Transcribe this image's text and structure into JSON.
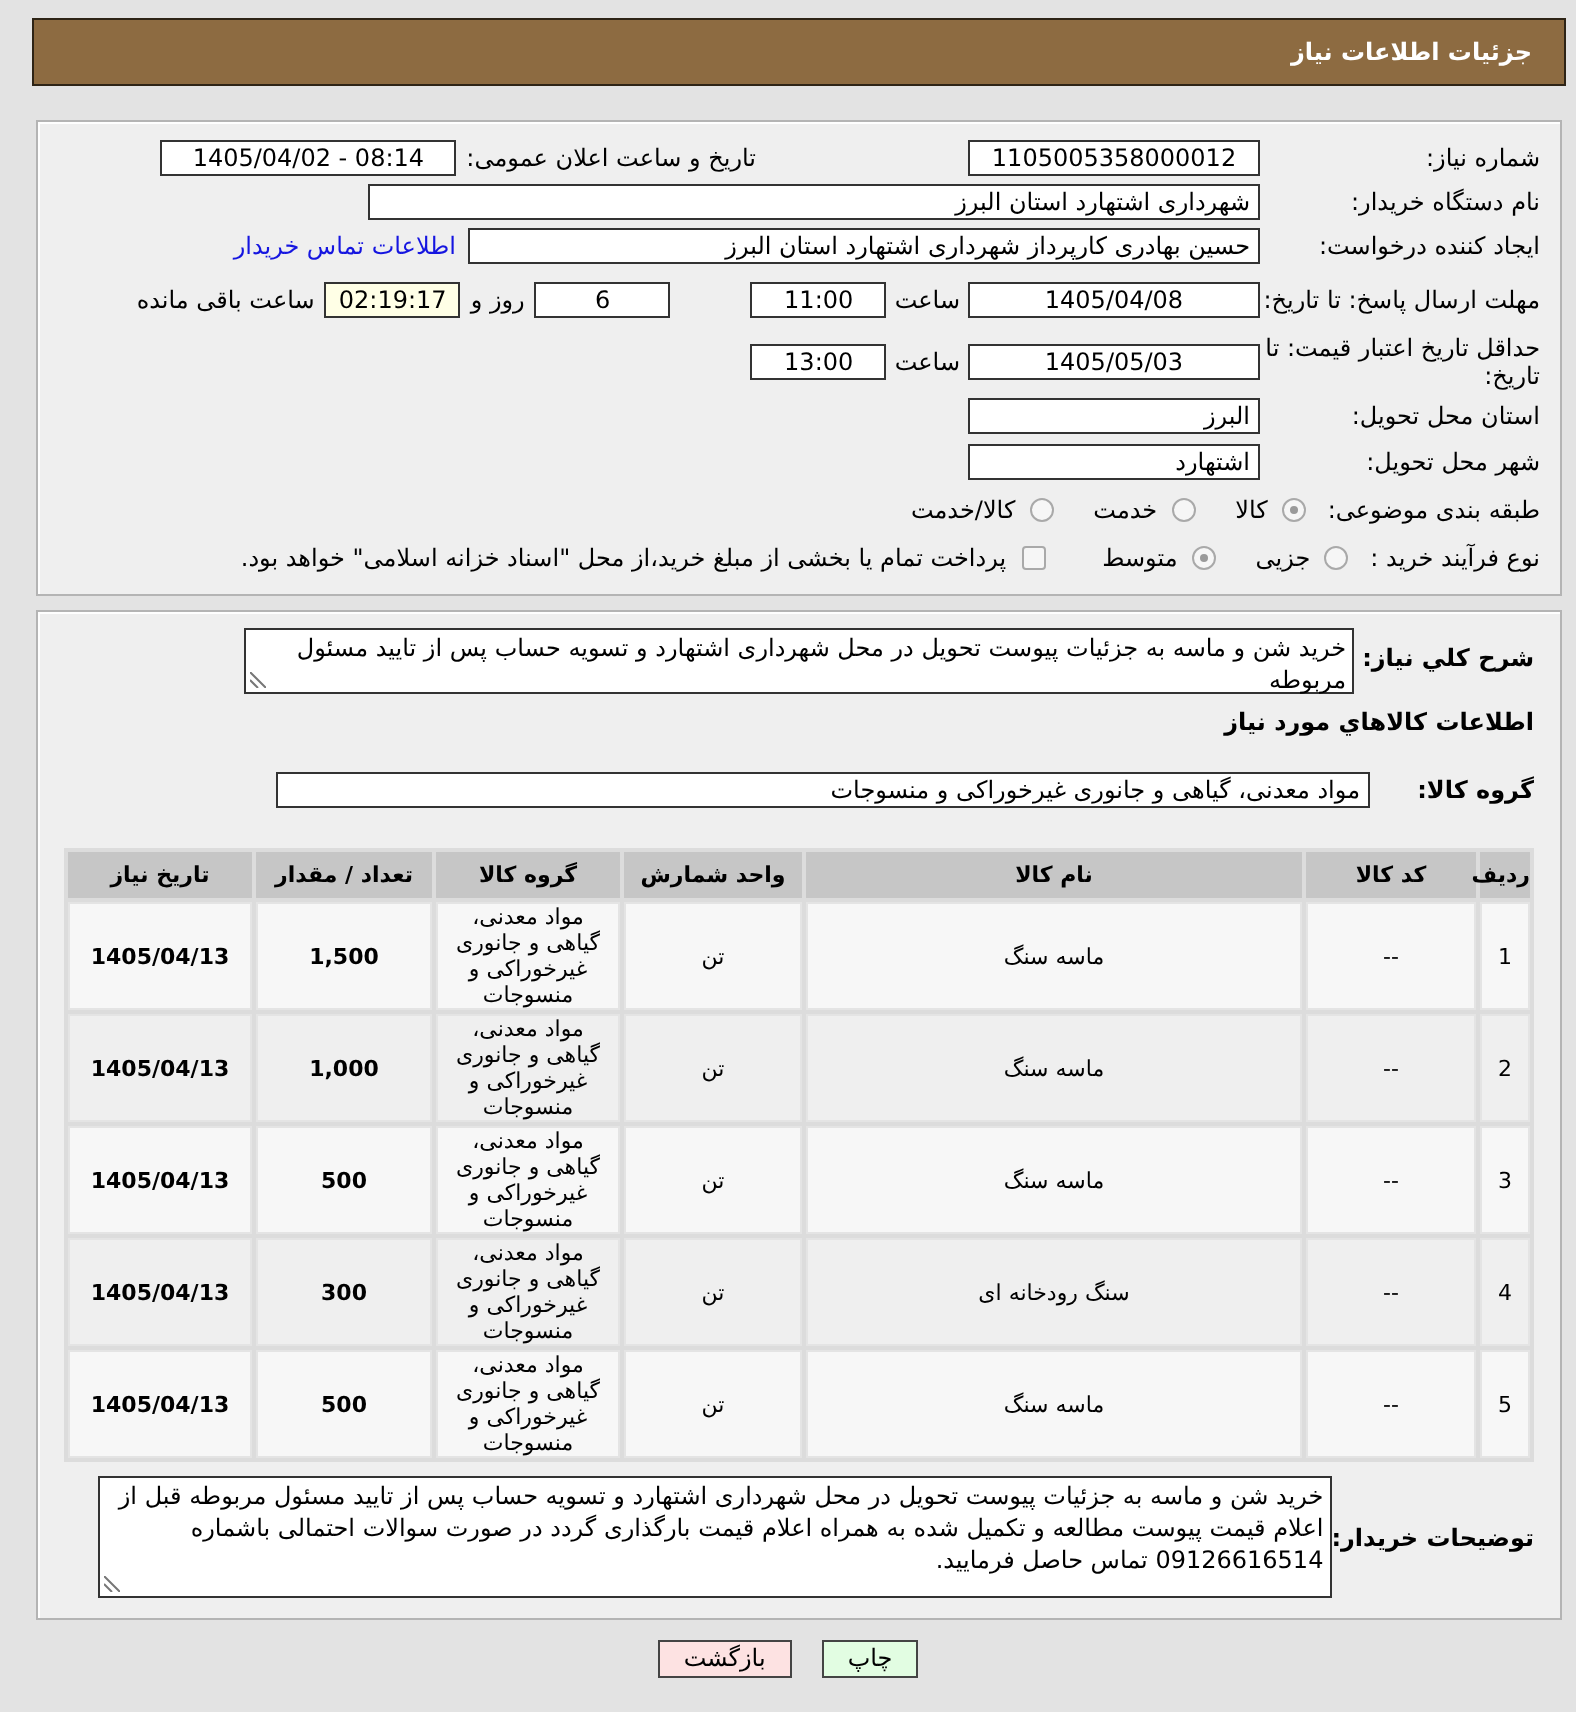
{
  "header": {
    "title": "جزئیات اطلاعات نیاز"
  },
  "details": {
    "need_number": {
      "label": "شماره نیاز:",
      "value": "1105005358000012"
    },
    "announcement": {
      "label": "تاریخ و ساعت اعلان عمومی:",
      "value": "1405/04/02 - 08:14"
    },
    "buyer_organization": {
      "label": "نام دستگاه خریدار:",
      "value": "شهرداری اشتهارد استان البرز"
    },
    "requester": {
      "label": "ایجاد کننده درخواست:",
      "value": "حسین بهادری کارپرداز شهرداری اشتهارد استان البرز",
      "contact_link": "اطلاعات تماس خریدار"
    },
    "response_deadline": {
      "label": "مهلت ارسال پاسخ: تا تاریخ:",
      "date": "1405/04/08",
      "time_label": "ساعت",
      "time": "11:00",
      "days": "6",
      "days_label": "روز و",
      "remaining": "02:19:17",
      "remaining_label": "ساعت باقی مانده"
    },
    "price_validity": {
      "label": "حداقل تاریخ اعتبار قیمت: تا تاریخ:",
      "date": "1405/05/03",
      "time_label": "ساعت",
      "time": "13:00"
    },
    "delivery_province": {
      "label": "استان محل تحویل:",
      "value": "البرز"
    },
    "delivery_city": {
      "label": "شهر محل تحویل:",
      "value": "اشتهارد"
    },
    "subject_category": {
      "label": "طبقه بندی موضوعی:",
      "options": [
        {
          "label": "کالا",
          "selected": true
        },
        {
          "label": "خدمت",
          "selected": false
        },
        {
          "label": "کالا/خدمت",
          "selected": false
        }
      ]
    },
    "purchase_process": {
      "label": "نوع فرآیند خرید :",
      "options": [
        {
          "label": "جزیی",
          "selected": false
        },
        {
          "label": "متوسط",
          "selected": true
        }
      ],
      "treasury_payment": {
        "label": "پرداخت تمام یا بخشی از مبلغ خرید،از محل \"اسناد خزانه اسلامی\" خواهد بود.",
        "checked": false
      }
    }
  },
  "goods": {
    "description": {
      "label": "شرح کلي نیاز:",
      "value": "خرید شن و ماسه به جزئیات پیوست تحویل در محل شهرداری اشتهارد و تسویه حساب پس از تایید مسئول مربوطه"
    },
    "section_title": "اطلاعات کالاهاي مورد نیاز",
    "group": {
      "label": "گروه کالا:",
      "value": "مواد معدنی، گیاهی و جانوری غیرخوراکی و منسوجات"
    },
    "table": {
      "columns": [
        "ردیف",
        "کد کالا",
        "نام کالا",
        "واحد شمارش",
        "گروه کالا",
        "تعداد / مقدار",
        "تاریخ نیاز"
      ],
      "rows": [
        {
          "row": "1",
          "code": "--",
          "name": "ماسه سنگ",
          "unit": "تن",
          "group": "مواد معدنی، گیاهی و جانوری غیرخوراکی و منسوجات",
          "quantity": "1,500",
          "need_date": "1405/04/13"
        },
        {
          "row": "2",
          "code": "--",
          "name": "ماسه سنگ",
          "unit": "تن",
          "group": "مواد معدنی، گیاهی و جانوری غیرخوراکی و منسوجات",
          "quantity": "1,000",
          "need_date": "1405/04/13"
        },
        {
          "row": "3",
          "code": "--",
          "name": "ماسه سنگ",
          "unit": "تن",
          "group": "مواد معدنی، گیاهی و جانوری غیرخوراکی و منسوجات",
          "quantity": "500",
          "need_date": "1405/04/13"
        },
        {
          "row": "4",
          "code": "--",
          "name": "سنگ رودخانه ای",
          "unit": "تن",
          "group": "مواد معدنی، گیاهی و جانوری غیرخوراکی و منسوجات",
          "quantity": "300",
          "need_date": "1405/04/13"
        },
        {
          "row": "5",
          "code": "--",
          "name": "ماسه سنگ",
          "unit": "تن",
          "group": "مواد معدنی، گیاهی و جانوری غیرخوراکی و منسوجات",
          "quantity": "500",
          "need_date": "1405/04/13"
        }
      ]
    },
    "buyer_notes": {
      "label": "توضیحات خریدار:",
      "value": "خرید شن و ماسه به جزئیات پیوست تحویل در محل شهرداری اشتهارد و تسویه حساب پس از تایید مسئول مربوطه  قبل از اعلام قیمت پیوست مطالعه و تکمیل شده به همراه اعلام قیمت بارگذاری گردد در صورت سوالات احتمالی باشماره 09126616514 تماس حاصل فرمایید."
    }
  },
  "buttons": [
    {
      "label": "چاپ",
      "kind": "print"
    },
    {
      "label": "بازگشت",
      "kind": "back"
    }
  ]
}
